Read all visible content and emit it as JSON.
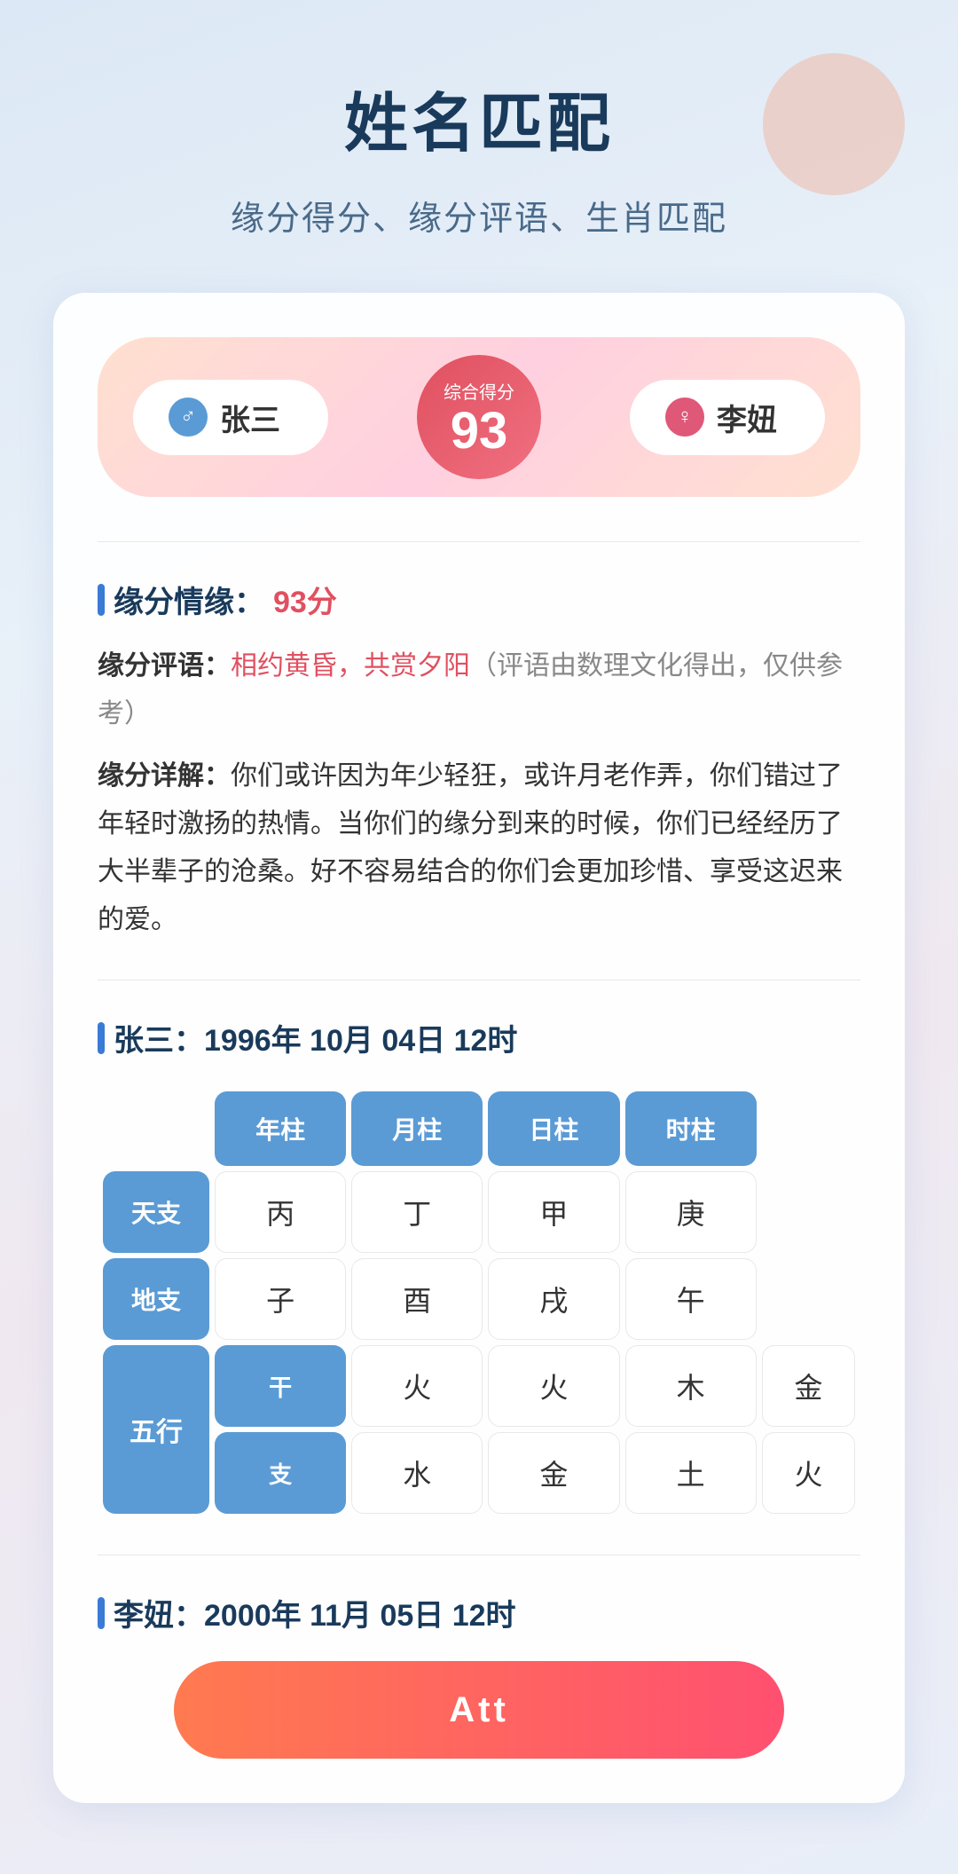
{
  "page": {
    "title": "姓名匹配",
    "subtitle": "缘分得分、缘分评语、生肖匹配"
  },
  "score_banner": {
    "person1": {
      "name": "张三",
      "gender": "male",
      "icon": "♂"
    },
    "person2": {
      "name": "李妞",
      "gender": "female",
      "icon": "♀"
    },
    "score_label": "综合得分",
    "score": "93"
  },
  "yuanfen_section": {
    "title": "缘分情缘：",
    "score_part": "93分",
    "comment_label": "缘分评语：",
    "comment_red": "相约黄昏，共赏夕阳",
    "comment_suffix": "（评语由数理文化得出，仅供参考）",
    "detail_label": "缘分详解：",
    "detail_text": "你们或许因为年少轻狂，或许月老作弄，你们错过了年轻时激扬的热情。当你们的缘分到来的时候，你们已经经历了大半辈子的沧桑。好不容易结合的你们会更加珍惜、享受这迟来的爱。"
  },
  "person1_bazi": {
    "title_prefix": "张三：",
    "title_date": "1996年 10月 04日 12时",
    "columns": [
      "年柱",
      "月柱",
      "日柱",
      "时柱"
    ],
    "rows": [
      {
        "row_label": "天支",
        "cells": [
          "丙",
          "丁",
          "甲",
          "庚"
        ]
      },
      {
        "row_label": "地支",
        "cells": [
          "子",
          "酉",
          "戌",
          "午"
        ]
      }
    ],
    "wuxing": {
      "label": "五行",
      "sub_rows": [
        {
          "sub_label": "干",
          "cells": [
            "火",
            "火",
            "木",
            "金"
          ]
        },
        {
          "sub_label": "支",
          "cells": [
            "水",
            "金",
            "土",
            "火"
          ]
        }
      ]
    }
  },
  "person2_bazi": {
    "title_prefix": "李妞：",
    "title_date": "2000年 11月 05日 12时"
  },
  "bottom_button": {
    "label": "Att"
  }
}
